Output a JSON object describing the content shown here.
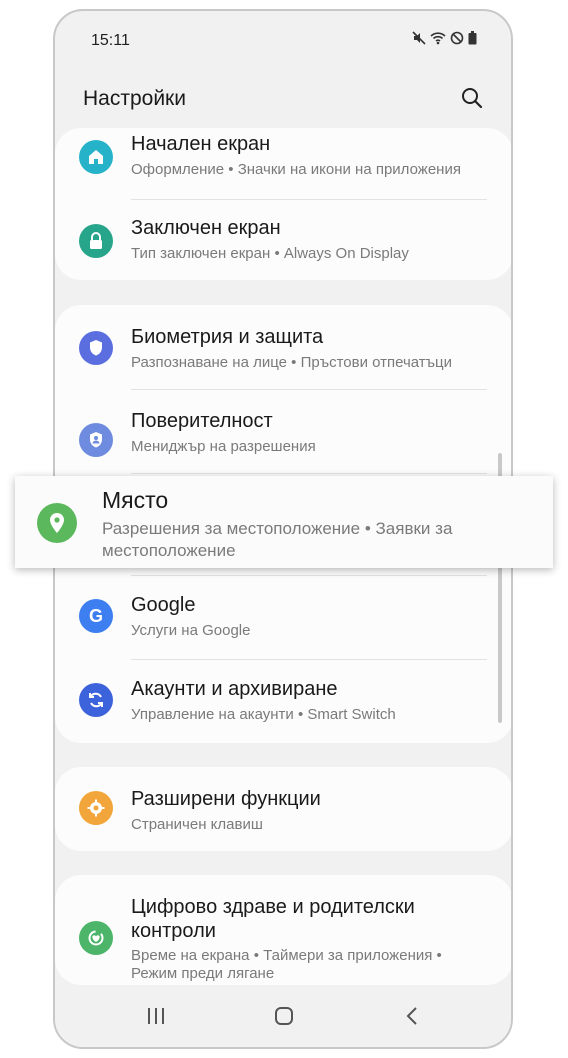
{
  "status": {
    "time": "15:11"
  },
  "header": {
    "title": "Настройки"
  },
  "card1": {
    "items": [
      {
        "title": "Начален екран",
        "subtitle": "Оформление  •  Значки на икони на приложения",
        "icon": "home-icon",
        "color": "#26b3c9"
      },
      {
        "title": "Заключен екран",
        "subtitle": "Тип заключен екран  •  Always On Display",
        "icon": "lock-icon",
        "color": "#27a58a"
      }
    ]
  },
  "card2": {
    "items": [
      {
        "title": "Биометрия и защита",
        "subtitle": "Разпознаване на лице  •  Пръстови отпечатъци",
        "icon": "shield-icon",
        "color": "#5b6ee0"
      },
      {
        "title": "Поверителност",
        "subtitle": "Мениджър на разрешения",
        "icon": "privacy-icon",
        "color": "#6e8be0"
      },
      {
        "title": "Google",
        "subtitle": "Услуги на Google",
        "icon": "google-icon",
        "color": "#3d7ef0"
      },
      {
        "title": "Акаунти и архивиране",
        "subtitle": "Управление на акаунти  •  Smart Switch",
        "icon": "sync-icon",
        "color": "#3d63dc"
      }
    ]
  },
  "card3": {
    "items": [
      {
        "title": "Разширени функции",
        "subtitle": "Страничен клавиш",
        "icon": "gear-plus-icon",
        "color": "#f2a53a"
      }
    ]
  },
  "card4": {
    "items": [
      {
        "title": "Цифрово здраве и родителски контроли",
        "subtitle": "Време на екрана  •  Таймери за приложения  •  Режим преди лягане",
        "icon": "wellbeing-icon",
        "color": "#4cb56a"
      }
    ]
  },
  "popup": {
    "title": "Място",
    "subtitle": "Разрешения за местоположение  •  Заявки за местоположение",
    "icon": "location-pin-icon",
    "color": "#5cb85c"
  }
}
